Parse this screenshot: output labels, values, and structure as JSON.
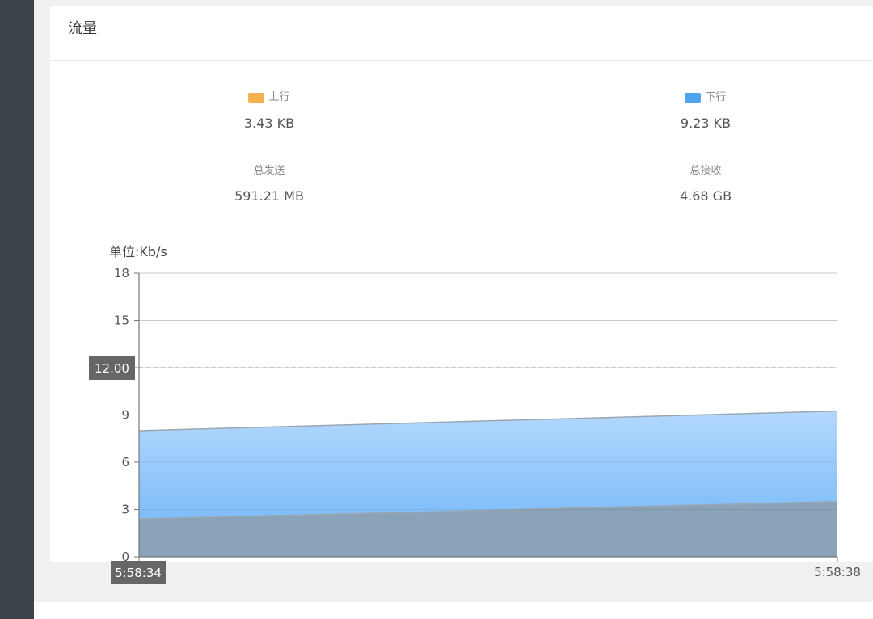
{
  "panel": {
    "title": "流量"
  },
  "stats": {
    "upload": {
      "label": "上行",
      "value": "3.43 KB",
      "color": "#f2b34c"
    },
    "download": {
      "label": "下行",
      "value": "9.23 KB",
      "color": "#4fa4f2"
    },
    "total_sent": {
      "label": "总发送",
      "value": "591.21 MB"
    },
    "total_received": {
      "label": "总接收",
      "value": "4.68 GB"
    }
  },
  "chart_data": {
    "type": "area",
    "stacked": true,
    "unit_label": "单位:Kb/s",
    "x": [
      "5:58:34",
      "5:58:38"
    ],
    "ylim": [
      0,
      18
    ],
    "y_ticks": [
      0,
      3,
      6,
      9,
      12,
      15,
      18
    ],
    "series": [
      {
        "name": "上行",
        "values": [
          2.4,
          3.5
        ],
        "color": "#8aa3b8"
      },
      {
        "name": "下行",
        "values": [
          5.6,
          5.75
        ],
        "color": "#7fbdfa"
      }
    ],
    "pointer": {
      "y_value": "12.00",
      "x_value": "5:58:34"
    },
    "grid": true
  }
}
